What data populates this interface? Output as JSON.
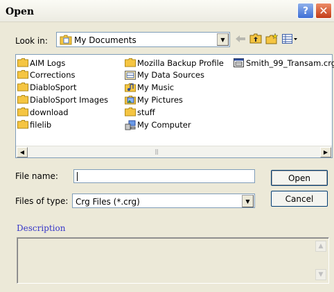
{
  "window": {
    "title": "Open",
    "help_label": "?",
    "close_label": "✕"
  },
  "lookin": {
    "label": "Look in:",
    "value": "My Documents"
  },
  "files": [
    {
      "name": "AIM Logs",
      "icon": "folder-icon"
    },
    {
      "name": "Corrections",
      "icon": "folder-icon"
    },
    {
      "name": "DiabloSport",
      "icon": "folder-icon"
    },
    {
      "name": "DiabloSport Images",
      "icon": "folder-icon"
    },
    {
      "name": "download",
      "icon": "folder-icon"
    },
    {
      "name": "filelib",
      "icon": "folder-icon"
    },
    {
      "name": "Mozilla Backup Profile",
      "icon": "folder-icon"
    },
    {
      "name": "My Data Sources",
      "icon": "data-sources-icon"
    },
    {
      "name": "My Music",
      "icon": "music-folder-icon"
    },
    {
      "name": "My Pictures",
      "icon": "pictures-folder-icon"
    },
    {
      "name": "stuff",
      "icon": "folder-icon"
    },
    {
      "name": "My Computer",
      "icon": "computer-icon"
    },
    {
      "name": "Smith_99_Transam.crg",
      "icon": "crg-file-icon"
    }
  ],
  "filename": {
    "label": "File name:",
    "value": ""
  },
  "filetype": {
    "label": "Files of type:",
    "value": "Crg Files (*.crg)"
  },
  "buttons": {
    "open": "Open",
    "cancel": "Cancel"
  },
  "description": {
    "label": "Description"
  },
  "colors": {
    "accent": "#3535c8",
    "title_close": "#c33d18",
    "title_help": "#3f6fd6",
    "folder": "#f5c542"
  }
}
